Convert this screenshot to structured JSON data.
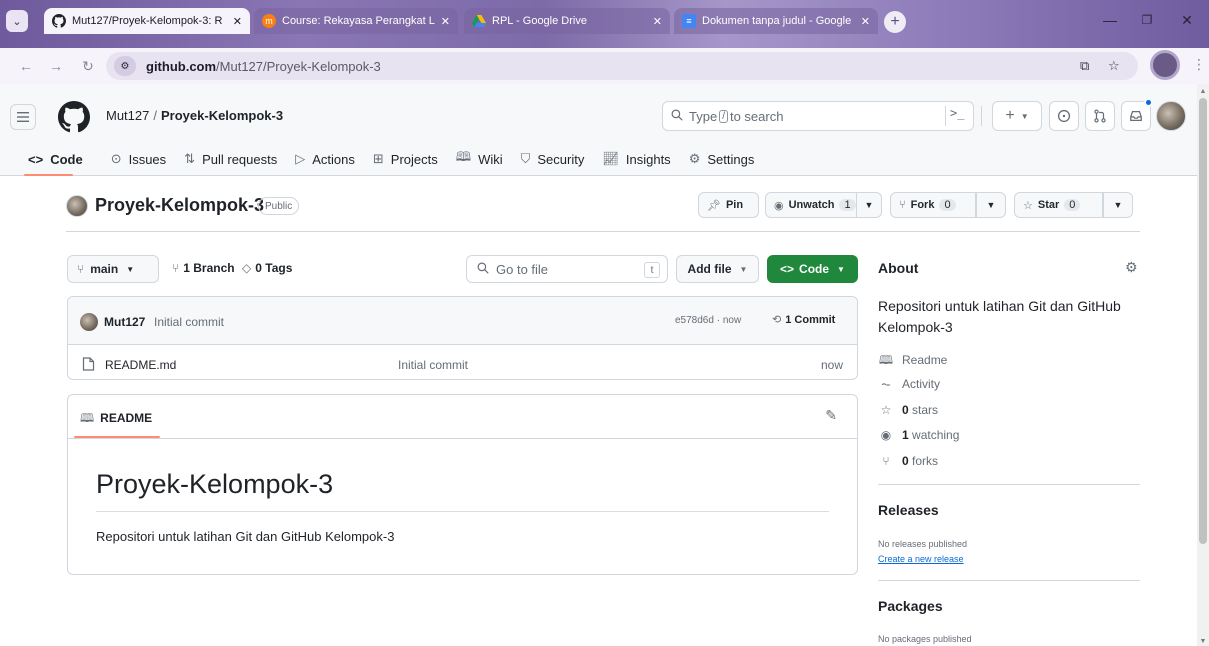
{
  "browser": {
    "tabs": [
      {
        "title": "Mut127/Proyek-Kelompok-3: R",
        "active": true,
        "icon": "github-icon"
      },
      {
        "title": "Course: Rekayasa Perangkat Lun",
        "active": false,
        "icon": "moodle-icon"
      },
      {
        "title": "RPL - Google Drive",
        "active": false,
        "icon": "drive-icon"
      },
      {
        "title": "Dokumen tanpa judul - Google",
        "active": false,
        "icon": "docs-icon"
      }
    ],
    "url_domain": "github.com",
    "url_path": "/Mut127/Proyek-Kelompok-3"
  },
  "header": {
    "owner": "Mut127",
    "separator": "/",
    "repo": "Proyek-Kelompok-3",
    "search_prefix": "Type",
    "search_key": "/",
    "search_suffix": "to search",
    "cmd_palette": ">_"
  },
  "repo_nav": [
    {
      "label": "Code",
      "icon": "code-icon",
      "active": true
    },
    {
      "label": "Issues",
      "icon": "issue-icon",
      "active": false
    },
    {
      "label": "Pull requests",
      "icon": "pull-request-icon",
      "active": false
    },
    {
      "label": "Actions",
      "icon": "play-icon",
      "active": false
    },
    {
      "label": "Projects",
      "icon": "table-icon",
      "active": false
    },
    {
      "label": "Wiki",
      "icon": "book-icon",
      "active": false
    },
    {
      "label": "Security",
      "icon": "shield-icon",
      "active": false
    },
    {
      "label": "Insights",
      "icon": "graph-icon",
      "active": false
    },
    {
      "label": "Settings",
      "icon": "gear-icon",
      "active": false
    }
  ],
  "repo": {
    "name": "Proyek-Kelompok-3",
    "visibility": "Public",
    "pin_label": "Pin",
    "unwatch_label": "Unwatch",
    "unwatch_count": "1",
    "fork_label": "Fork",
    "fork_count": "0",
    "star_label": "Star",
    "star_count": "0"
  },
  "filebar": {
    "branch": "main",
    "branch_count": "1",
    "branch_label": "Branch",
    "tag_count": "0",
    "tag_label": "Tags",
    "goto_placeholder": "Go to file",
    "goto_key": "t",
    "add_file": "Add file",
    "code_button": "Code"
  },
  "latest_commit": {
    "user": "Mut127",
    "message": "Initial commit",
    "sha_time": "e578d6d · now",
    "commit_count": "1",
    "commit_label": "Commit"
  },
  "files": [
    {
      "name": "README.md",
      "message": "Initial commit",
      "time": "now"
    }
  ],
  "readme": {
    "tab_label": "README",
    "heading": "Proyek-Kelompok-3",
    "body": "Repositori untuk latihan Git dan GitHub Kelompok-3"
  },
  "about": {
    "title": "About",
    "description": "Repositori untuk latihan Git dan GitHub Kelompok-3",
    "readme_link": "Readme",
    "activity_link": "Activity",
    "stars_count": "0",
    "stars_label": "stars",
    "watching_count": "1",
    "watching_label": "watching",
    "forks_count": "0",
    "forks_label": "forks"
  },
  "releases": {
    "title": "Releases",
    "empty": "No releases published",
    "create_link": "Create a new release"
  },
  "packages": {
    "title": "Packages",
    "empty": "No packages published"
  },
  "colors": {
    "accent_green": "#1f883d",
    "tab_underline": "#fd8c73",
    "link_blue": "#0969da"
  }
}
